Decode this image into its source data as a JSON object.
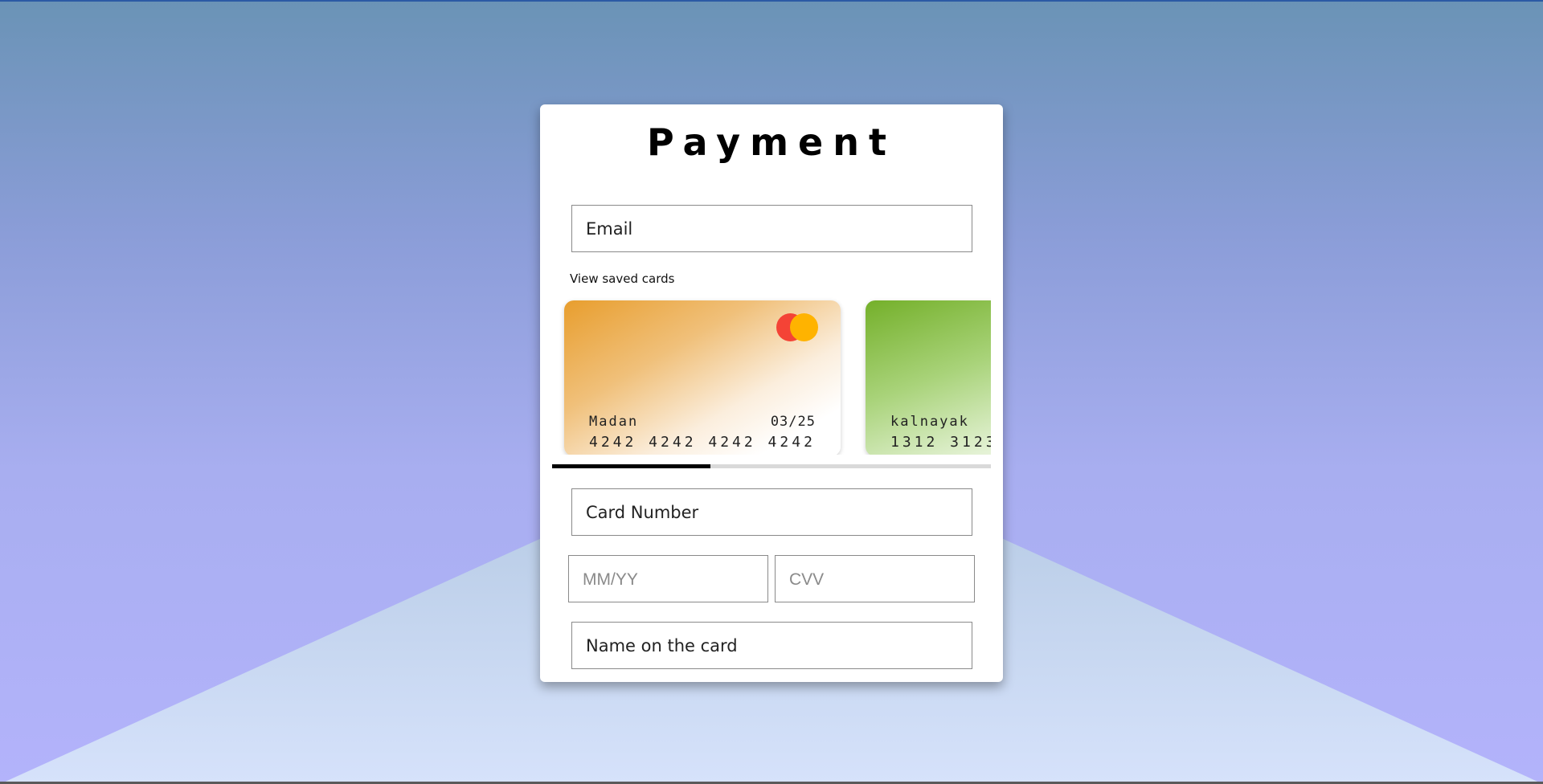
{
  "page": {
    "title": "Payment"
  },
  "form": {
    "email_placeholder": "Email",
    "saved_cards_label": "View saved cards",
    "card_number_placeholder": "Card Number",
    "expiry_placeholder": "MM/YY",
    "cvv_placeholder": "CVV",
    "name_placeholder": "Name on the card"
  },
  "saved_cards": [
    {
      "holder": "Madan",
      "expiry": "03/25",
      "number": "4242 4242 4242 4242",
      "brand_icon": "mastercard-logo",
      "gradient": "#e89e2e"
    },
    {
      "holder": "kalnayak",
      "number": "1312 3123",
      "gradient": "#74b02a"
    }
  ],
  "scrollbar": {
    "position_fraction": 0.36
  },
  "colors": {
    "background_top": "#6a93b6",
    "background_bottom": "#b3b3fb",
    "panel": "#ffffff",
    "mastercard_red": "#f44336",
    "mastercard_yellow": "#ffb300"
  }
}
